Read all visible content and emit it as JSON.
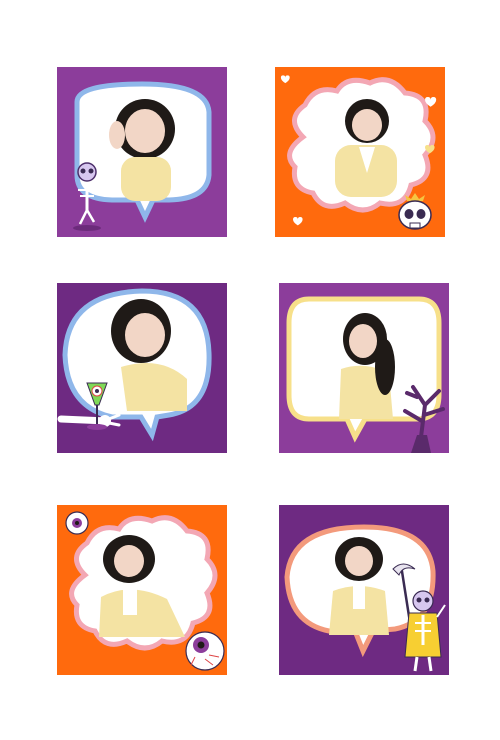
{
  "palette": {
    "purple": "#8c3d9b",
    "deep_purple": "#6e2a82",
    "orange": "#ff6a0d",
    "blue_border": "#8fb7ea",
    "pink_border": "#f3a7b4",
    "yellow_border": "#f7e08a",
    "salmon_border": "#f39a7c",
    "sweater": "#f4e3a3",
    "hair": "#1f1a17",
    "skin": "#f2d6c6"
  },
  "cards": [
    {
      "name": "card-1",
      "bg": "purple",
      "frame": "speech-oval",
      "border": "blue_border",
      "sticker": "skeleton-sticker"
    },
    {
      "name": "card-2",
      "bg": "orange",
      "frame": "cloud",
      "border": "pink_border",
      "sticker": "skull-sticker"
    },
    {
      "name": "card-3",
      "bg": "deep_purple",
      "frame": "speech-oval",
      "border": "blue_border",
      "sticker": "skeleton-hand-sticker"
    },
    {
      "name": "card-4",
      "bg": "purple",
      "frame": "speech-rect",
      "border": "yellow_border",
      "sticker": "dead-tree-sticker"
    },
    {
      "name": "card-5",
      "bg": "orange",
      "frame": "cloud",
      "border": "pink_border",
      "sticker": "eyeball-sticker"
    },
    {
      "name": "card-6",
      "bg": "deep_purple",
      "frame": "speech-oval",
      "border": "salmon_border",
      "sticker": "grim-reaper-sticker"
    }
  ]
}
